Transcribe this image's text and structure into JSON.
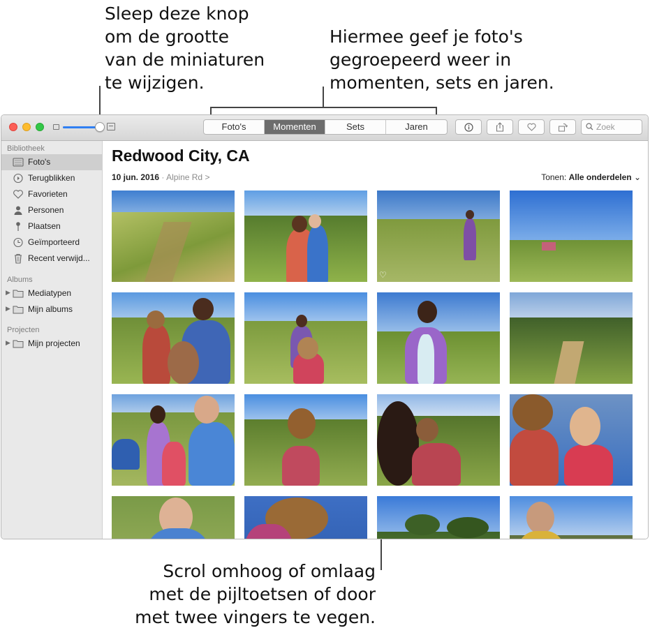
{
  "callouts": {
    "slider": "Sleep deze knop\nom de grootte\nvan de miniaturen\nte wijzigen.",
    "segments": "Hiermee geef je foto's\ngegroepeerd weer in\nmomenten, sets en jaren.",
    "scroll": "Scrol omhoog of omlaag\nmet de pijltoetsen of door\nmet twee vingers te vegen."
  },
  "toolbar": {
    "segments": [
      "Foto's",
      "Momenten",
      "Sets",
      "Jaren"
    ],
    "active_segment": "Momenten",
    "search_placeholder": "Zoek",
    "thumbnail_size_level": 0.85
  },
  "sidebar": {
    "library_header": "Bibliotheek",
    "library_items": [
      {
        "label": "Foto's",
        "icon": "photos-icon",
        "selected": true
      },
      {
        "label": "Terugblikken",
        "icon": "memories-icon"
      },
      {
        "label": "Favorieten",
        "icon": "heart-icon"
      },
      {
        "label": "Personen",
        "icon": "person-icon"
      },
      {
        "label": "Plaatsen",
        "icon": "pin-icon"
      },
      {
        "label": "Geïmporteerd",
        "icon": "clock-icon"
      },
      {
        "label": "Recent verwijd...",
        "icon": "trash-icon"
      }
    ],
    "albums_header": "Albums",
    "album_items": [
      {
        "label": "Mediatypen",
        "icon": "folder-icon"
      },
      {
        "label": "Mijn albums",
        "icon": "folder-icon"
      }
    ],
    "projects_header": "Projecten",
    "project_items": [
      {
        "label": "Mijn projecten",
        "icon": "folder-icon"
      }
    ]
  },
  "main": {
    "title": "Redwood City, CA",
    "date": "10 jun. 2016",
    "separator": "·",
    "location": "Alpine Rd",
    "location_chevron": ">",
    "show_label": "Tonen:",
    "show_value": "Alle onderdelen",
    "show_chevron": "⌄"
  },
  "colors": {
    "accent": "#2f7ff2",
    "sky": "#5c95d8",
    "grass": "#8aa84e",
    "active_segment": "#6d6d6d"
  }
}
